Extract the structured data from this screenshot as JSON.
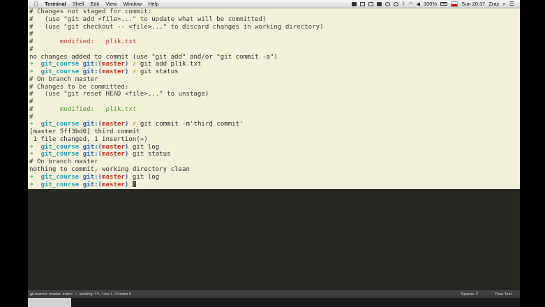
{
  "menubar": {
    "items": [
      "Terminal",
      "Shell",
      "Edit",
      "View",
      "Window",
      "Help"
    ],
    "battery": "100%",
    "clock": "Sun 20:37",
    "user": "Zraz"
  },
  "terminal": {
    "lines": [
      [
        {
          "t": "# Changes not staged for commit:",
          "c": "c-comment"
        }
      ],
      [
        {
          "t": "#   (use \"git add <file>...\" to update what will be committed)",
          "c": "c-comment"
        }
      ],
      [
        {
          "t": "#   (use \"git checkout -- <file>...\" to discard changes in working directory)",
          "c": "c-comment"
        }
      ],
      [
        {
          "t": "#",
          "c": "c-comment"
        }
      ],
      [
        {
          "t": "#       ",
          "c": "c-comment"
        },
        {
          "t": "modified:   plik.txt",
          "c": "c-mod"
        }
      ],
      [
        {
          "t": "#",
          "c": "c-comment"
        }
      ],
      [
        {
          "t": "no changes added to commit (use \"git add\" and/or \"git commit -a\")",
          "c": ""
        }
      ],
      [
        {
          "t": "➜  ",
          "c": "c-arrow"
        },
        {
          "t": "git_course",
          "c": "c-dir"
        },
        {
          "t": " git:(",
          "c": "c-git"
        },
        {
          "t": "master",
          "c": "c-branch"
        },
        {
          "t": ")",
          "c": "c-git"
        },
        {
          "t": " ✗",
          "c": "c-x"
        },
        {
          "t": " git add plik.txt",
          "c": ""
        }
      ],
      [
        {
          "t": "➜  ",
          "c": "c-arrow"
        },
        {
          "t": "git_course",
          "c": "c-dir"
        },
        {
          "t": " git:(",
          "c": "c-git"
        },
        {
          "t": "master",
          "c": "c-branch"
        },
        {
          "t": ")",
          "c": "c-git"
        },
        {
          "t": " ✗",
          "c": "c-x"
        },
        {
          "t": " git status",
          "c": ""
        }
      ],
      [
        {
          "t": "# On branch master",
          "c": "c-comment"
        }
      ],
      [
        {
          "t": "# Changes to be committed:",
          "c": "c-comment"
        }
      ],
      [
        {
          "t": "#   (use \"git reset HEAD <file>...\" to unstage)",
          "c": "c-comment"
        }
      ],
      [
        {
          "t": "#",
          "c": "c-comment"
        }
      ],
      [
        {
          "t": "#       ",
          "c": "c-comment"
        },
        {
          "t": "modified:   plik.txt",
          "c": "c-mod-green"
        }
      ],
      [
        {
          "t": "#",
          "c": "c-comment"
        }
      ],
      [
        {
          "t": "➜  ",
          "c": "c-arrow"
        },
        {
          "t": "git_course",
          "c": "c-dir"
        },
        {
          "t": " git:(",
          "c": "c-git"
        },
        {
          "t": "master",
          "c": "c-branch"
        },
        {
          "t": ")",
          "c": "c-git"
        },
        {
          "t": " ✗",
          "c": "c-x"
        },
        {
          "t": " git commit -m'third commit'",
          "c": ""
        }
      ],
      [
        {
          "t": "[master 5ff3bd0] third commit",
          "c": ""
        }
      ],
      [
        {
          "t": " 1 file changed, 1 insertion(+)",
          "c": ""
        }
      ],
      [
        {
          "t": "➜  ",
          "c": "c-arrow"
        },
        {
          "t": "git_course",
          "c": "c-dir"
        },
        {
          "t": " git:(",
          "c": "c-git"
        },
        {
          "t": "master",
          "c": "c-branch"
        },
        {
          "t": ")",
          "c": "c-git"
        },
        {
          "t": " git log",
          "c": ""
        }
      ],
      [
        {
          "t": "➜  ",
          "c": "c-arrow"
        },
        {
          "t": "git_course",
          "c": "c-dir"
        },
        {
          "t": " git:(",
          "c": "c-git"
        },
        {
          "t": "master",
          "c": "c-branch"
        },
        {
          "t": ")",
          "c": "c-git"
        },
        {
          "t": " git status",
          "c": ""
        }
      ],
      [
        {
          "t": "# On branch master",
          "c": "c-comment"
        }
      ],
      [
        {
          "t": "nothing to commit, working directory clean",
          "c": ""
        }
      ],
      [
        {
          "t": "➜  ",
          "c": "c-arrow"
        },
        {
          "t": "git_course",
          "c": "c-dir"
        },
        {
          "t": " git:(",
          "c": "c-git"
        },
        {
          "t": "master",
          "c": "c-branch"
        },
        {
          "t": ")",
          "c": "c-git"
        },
        {
          "t": " git log",
          "c": ""
        }
      ],
      [
        {
          "t": "➜  ",
          "c": "c-arrow"
        },
        {
          "t": "git_course",
          "c": "c-dir"
        },
        {
          "t": " git:(",
          "c": "c-git"
        },
        {
          "t": "master",
          "c": "c-branch"
        },
        {
          "t": ")",
          "c": "c-git"
        },
        {
          "t": " ",
          "c": ""
        }
      ]
    ]
  },
  "statusbar": {
    "left": "git branch: master, index: ✓, working: 1✎, Line 1, Column 9",
    "spaces": "Spaces: 2",
    "syntax": "Plain Text"
  }
}
